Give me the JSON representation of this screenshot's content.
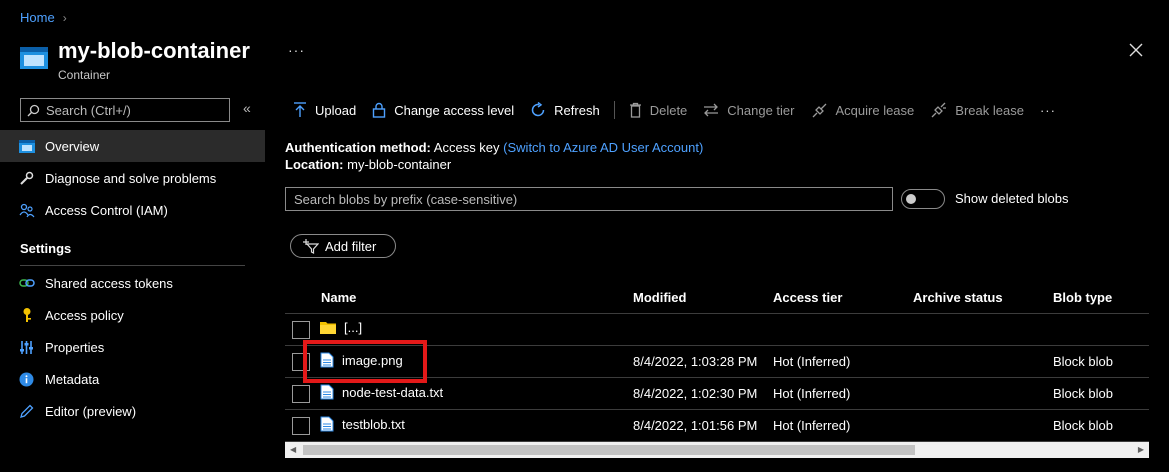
{
  "breadcrumb": {
    "home": "Home"
  },
  "header": {
    "title": "my-blob-container",
    "subtitle": "Container",
    "more": "···"
  },
  "sidebar": {
    "search_placeholder": "Search (Ctrl+/)",
    "collapse": "«",
    "items": [
      {
        "label": "Overview",
        "icon": "container-icon",
        "active": true
      },
      {
        "label": "Diagnose and solve problems",
        "icon": "wrench-icon"
      },
      {
        "label": "Access Control (IAM)",
        "icon": "users-icon"
      }
    ],
    "settings_heading": "Settings",
    "settings_items": [
      {
        "label": "Shared access tokens",
        "icon": "link-icon"
      },
      {
        "label": "Access policy",
        "icon": "key-icon"
      },
      {
        "label": "Properties",
        "icon": "sliders-icon"
      },
      {
        "label": "Metadata",
        "icon": "info-icon"
      },
      {
        "label": "Editor (preview)",
        "icon": "pencil-icon"
      }
    ]
  },
  "toolbar": {
    "upload": "Upload",
    "change_access": "Change access level",
    "refresh": "Refresh",
    "delete": "Delete",
    "change_tier": "Change tier",
    "acquire_lease": "Acquire lease",
    "break_lease": "Break lease",
    "more": "···"
  },
  "info": {
    "auth_label": "Authentication method:",
    "auth_value": "Access key",
    "auth_link": "(Switch to Azure AD User Account)",
    "location_label": "Location:",
    "location_value": "my-blob-container"
  },
  "blob_search": {
    "placeholder": "Search blobs by prefix (case-sensitive)"
  },
  "toggle": {
    "label": "Show deleted blobs"
  },
  "filter": {
    "label": "Add filter"
  },
  "table": {
    "columns": {
      "name": "Name",
      "modified": "Modified",
      "tier": "Access tier",
      "archive": "Archive status",
      "type": "Blob type"
    },
    "rows": [
      {
        "name": "[...]",
        "icon": "folder-icon",
        "modified": "",
        "tier": "",
        "archive": "",
        "type": ""
      },
      {
        "name": "image.png",
        "icon": "file-icon",
        "modified": "8/4/2022, 1:03:28 PM",
        "tier": "Hot (Inferred)",
        "archive": "",
        "type": "Block blob"
      },
      {
        "name": "node-test-data.txt",
        "icon": "file-icon",
        "modified": "8/4/2022, 1:02:30 PM",
        "tier": "Hot (Inferred)",
        "archive": "",
        "type": "Block blob"
      },
      {
        "name": "testblob.txt",
        "icon": "file-icon",
        "modified": "8/4/2022, 1:01:56 PM",
        "tier": "Hot (Inferred)",
        "archive": "",
        "type": "Block blob"
      }
    ]
  },
  "colors": {
    "accent": "#4ea1ff",
    "highlight": "#e31919",
    "folder": "#f2c100"
  }
}
